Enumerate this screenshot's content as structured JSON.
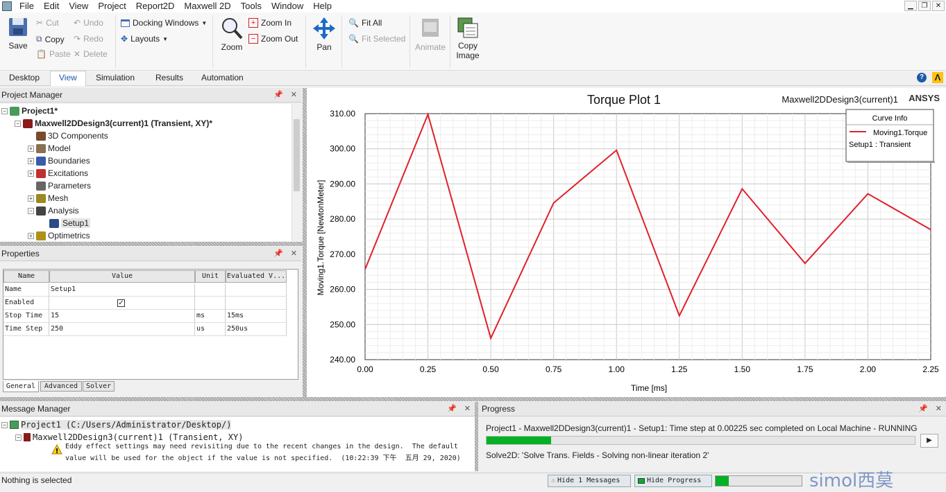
{
  "menu": [
    "File",
    "Edit",
    "View",
    "Project",
    "Report2D",
    "Maxwell 2D",
    "Tools",
    "Window",
    "Help"
  ],
  "ribbon": {
    "save": "Save",
    "cut": "Cut",
    "copy": "Copy",
    "paste": "Paste",
    "undo": "Undo",
    "redo": "Redo",
    "delete": "Delete",
    "docking": "Docking Windows",
    "layouts": "Layouts",
    "zoom": "Zoom",
    "zoom_in": "Zoom In",
    "zoom_out": "Zoom Out",
    "pan": "Pan",
    "fit_all": "Fit All",
    "fit_selected": "Fit Selected",
    "animate": "Animate",
    "copy_image_1": "Copy",
    "copy_image_2": "Image"
  },
  "tabs": [
    "Desktop",
    "View",
    "Simulation",
    "Results",
    "Automation"
  ],
  "active_tab": "View",
  "project_manager": {
    "title": "Project Manager",
    "items": [
      {
        "label": "Project1*",
        "level": 0,
        "exp": "-",
        "icon": "project-icon",
        "bold": true
      },
      {
        "label": "Maxwell2DDesign3(current)1 (Transient, XY)*",
        "level": 1,
        "exp": "-",
        "icon": "design-icon",
        "bold": true
      },
      {
        "label": "3D Components",
        "level": 2,
        "exp": "",
        "icon": "components-icon"
      },
      {
        "label": "Model",
        "level": 2,
        "exp": "+",
        "icon": "model-icon"
      },
      {
        "label": "Boundaries",
        "level": 2,
        "exp": "+",
        "icon": "boundaries-icon"
      },
      {
        "label": "Excitations",
        "level": 2,
        "exp": "+",
        "icon": "excitations-icon"
      },
      {
        "label": "Parameters",
        "level": 2,
        "exp": "",
        "icon": "parameters-icon"
      },
      {
        "label": "Mesh",
        "level": 2,
        "exp": "+",
        "icon": "mesh-icon"
      },
      {
        "label": "Analysis",
        "level": 2,
        "exp": "-",
        "icon": "analysis-icon"
      },
      {
        "label": "Setup1",
        "level": 3,
        "exp": "",
        "icon": "setup-icon"
      },
      {
        "label": "Optimetrics",
        "level": 2,
        "exp": "+",
        "icon": "optimetrics-icon"
      }
    ]
  },
  "properties": {
    "title": "Properties",
    "headers": [
      "Name",
      "Value",
      "Unit",
      "Evaluated V..."
    ],
    "rows": [
      {
        "name": "Name",
        "value": "Setup1",
        "unit": "",
        "eval": ""
      },
      {
        "name": "Enabled",
        "value": "",
        "unit": "",
        "eval": "",
        "checked": true
      },
      {
        "name": "Stop Time",
        "value": "15",
        "unit": "ms",
        "eval": "15ms"
      },
      {
        "name": "Time Step",
        "value": "250",
        "unit": "us",
        "eval": "250us"
      }
    ],
    "tabs": [
      "General",
      "Advanced",
      "Solver"
    ]
  },
  "plot": {
    "header_right": "Maxwell2DDesign3(current)1",
    "brand": "ANSYS",
    "legend_title": "Curve Info",
    "legend_series": "Moving1.Torque",
    "legend_setup": "Setup1 : Transient",
    "line_color": "#e0202a"
  },
  "chart_data": {
    "type": "line",
    "title": "Torque Plot 1",
    "xlabel": "Time [ms]",
    "ylabel": "Moving1.Torque [NewtonMeter]",
    "xlim": [
      0,
      2.25
    ],
    "ylim": [
      240,
      310
    ],
    "xticks": [
      "0.00",
      "0.25",
      "0.50",
      "0.75",
      "1.00",
      "1.25",
      "1.50",
      "1.75",
      "2.00",
      "2.25"
    ],
    "yticks": [
      "240.00",
      "250.00",
      "260.00",
      "270.00",
      "280.00",
      "290.00",
      "300.00",
      "310.00"
    ],
    "grid": true,
    "legend_position": "top-right",
    "series": [
      {
        "name": "Moving1.Torque",
        "x": [
          0,
          0.25,
          0.5,
          0.75,
          1.0,
          1.25,
          1.5,
          1.75,
          2.0,
          2.25
        ],
        "values": [
          265.7,
          309.8,
          246.1,
          284.6,
          299.6,
          252.5,
          288.6,
          267.4,
          287.2,
          277.0
        ]
      }
    ]
  },
  "message_manager": {
    "title": "Message Manager",
    "project": "Project1 (C:/Users/Administrator/Desktop/)",
    "design": "Maxwell2DDesign3(current)1 (Transient, XY)",
    "msg1": "Eddy effect settings may need revisiting due to the recent changes in the design.  The default",
    "msg2": "value will be used for the object if the value is not specified.  (10:22:39 下午  五月 29, 2020)"
  },
  "progress": {
    "title": "Progress",
    "line1": "Project1 - Maxwell2DDesign3(current)1 - Setup1: Time step at 0.00225 sec completed on Local Machine - RUNNING",
    "fraction": 0.15,
    "line2": "Solve2D: 'Solve Trans. Fields - Solving non-linear iteration 2'"
  },
  "status": {
    "text": "Nothing is selected",
    "hide_messages": "Hide 1 Messages",
    "hide_progress": "Hide Progress",
    "watermark": "simol西莫"
  }
}
